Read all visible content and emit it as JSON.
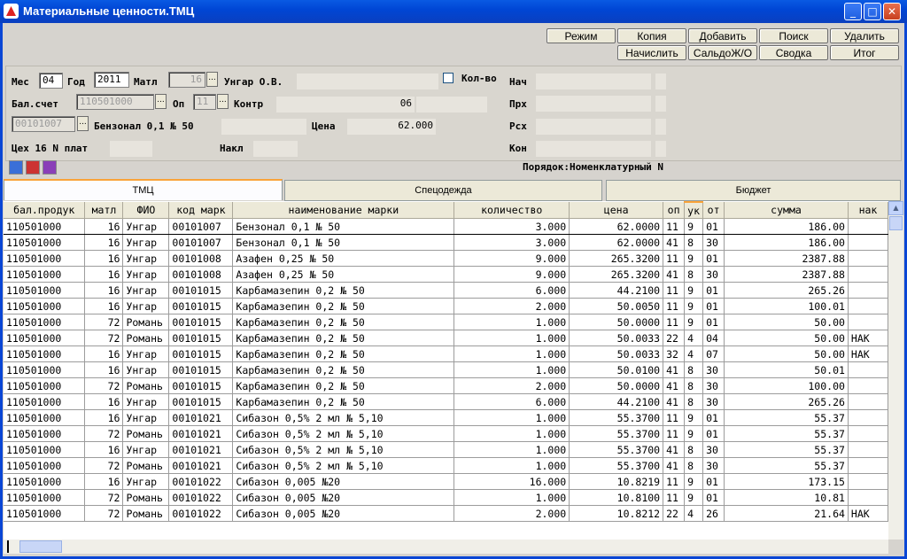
{
  "window": {
    "title": "Материальные ценности.ТМЦ",
    "minimize_icon": "minimize-icon",
    "maximize_icon": "maximize-icon",
    "close_icon": "close-icon"
  },
  "toolbar": {
    "rezhim": "Режим",
    "kopiya": "Копия",
    "dobavit": "Добавить",
    "poisk": "Поиск",
    "udalit": "Удалить",
    "nachislit": "Начислить",
    "saldo": "СальдоЖ/О",
    "svodka": "Сводка",
    "itog": "Итог"
  },
  "form": {
    "mes_label": "Мес",
    "mes_value": "04",
    "god_label": "Год",
    "god_value": "2011",
    "matl_label": "Матл",
    "matl_value": "16",
    "fio_value": "Унгар О.В.",
    "kolvo_label": "Кол-во",
    "nach_label": "Нач",
    "bal_label": "Бал.счет",
    "bal_value": "110501000",
    "op_label": "Оп",
    "op_value": "11",
    "kontr_label": "Контр",
    "kontr_value": "06",
    "prh_label": "Прх",
    "code_value": "00101007",
    "name_value": "Бензонал 0,1 № 50",
    "cena_label": "Цена",
    "cena_value": "62.000",
    "rsh_label": "Рсх",
    "ceh_label": "Цех 16 N плат",
    "nakl_label": "Накл",
    "kon_label": "Кон",
    "order_text": "Порядок:Номенклатурный N"
  },
  "tools": [
    "arrow-down-icon",
    "books-icon",
    "calendar-icon"
  ],
  "tabs": [
    "ТМЦ",
    "Спецодежда",
    "Бюджет"
  ],
  "table": {
    "columns": [
      "бал.продук",
      "матл",
      "ФИО",
      "код марк",
      "наименование марки",
      "количество",
      "цена",
      "оп",
      "ук",
      "от",
      "сумма",
      "нак"
    ],
    "rows": [
      [
        "110501000",
        "16",
        "Унгар",
        "00101007",
        "Бензонал 0,1 № 50",
        "3.000",
        "62.0000",
        "11",
        "9",
        "01",
        "186.00",
        ""
      ],
      [
        "110501000",
        "16",
        "Унгар",
        "00101007",
        "Бензонал 0,1 № 50",
        "3.000",
        "62.0000",
        "41",
        "8",
        "30",
        "186.00",
        ""
      ],
      [
        "110501000",
        "16",
        "Унгар",
        "00101008",
        "Азафен 0,25 № 50",
        "9.000",
        "265.3200",
        "11",
        "9",
        "01",
        "2387.88",
        ""
      ],
      [
        "110501000",
        "16",
        "Унгар",
        "00101008",
        "Азафен 0,25 № 50",
        "9.000",
        "265.3200",
        "41",
        "8",
        "30",
        "2387.88",
        ""
      ],
      [
        "110501000",
        "16",
        "Унгар",
        "00101015",
        "Карбамазепин 0,2 № 50",
        "6.000",
        "44.2100",
        "11",
        "9",
        "01",
        "265.26",
        ""
      ],
      [
        "110501000",
        "16",
        "Унгар",
        "00101015",
        "Карбамазепин 0,2 № 50",
        "2.000",
        "50.0050",
        "11",
        "9",
        "01",
        "100.01",
        ""
      ],
      [
        "110501000",
        "72",
        "Романь",
        "00101015",
        "Карбамазепин 0,2 № 50",
        "1.000",
        "50.0000",
        "11",
        "9",
        "01",
        "50.00",
        ""
      ],
      [
        "110501000",
        "72",
        "Романь",
        "00101015",
        "Карбамазепин 0,2 № 50",
        "1.000",
        "50.0033",
        "22",
        "4",
        "04",
        "50.00",
        "НАК"
      ],
      [
        "110501000",
        "16",
        "Унгар",
        "00101015",
        "Карбамазепин 0,2 № 50",
        "1.000",
        "50.0033",
        "32",
        "4",
        "07",
        "50.00",
        "НАК"
      ],
      [
        "110501000",
        "16",
        "Унгар",
        "00101015",
        "Карбамазепин 0,2 № 50",
        "1.000",
        "50.0100",
        "41",
        "8",
        "30",
        "50.01",
        ""
      ],
      [
        "110501000",
        "72",
        "Романь",
        "00101015",
        "Карбамазепин 0,2 № 50",
        "2.000",
        "50.0000",
        "41",
        "8",
        "30",
        "100.00",
        ""
      ],
      [
        "110501000",
        "16",
        "Унгар",
        "00101015",
        "Карбамазепин 0,2 № 50",
        "6.000",
        "44.2100",
        "41",
        "8",
        "30",
        "265.26",
        ""
      ],
      [
        "110501000",
        "16",
        "Унгар",
        "00101021",
        "Сибазон  0,5% 2 мл № 5,10",
        "1.000",
        "55.3700",
        "11",
        "9",
        "01",
        "55.37",
        ""
      ],
      [
        "110501000",
        "72",
        "Романь",
        "00101021",
        "Сибазон  0,5% 2 мл № 5,10",
        "1.000",
        "55.3700",
        "11",
        "9",
        "01",
        "55.37",
        ""
      ],
      [
        "110501000",
        "16",
        "Унгар",
        "00101021",
        "Сибазон  0,5% 2 мл № 5,10",
        "1.000",
        "55.3700",
        "41",
        "8",
        "30",
        "55.37",
        ""
      ],
      [
        "110501000",
        "72",
        "Романь",
        "00101021",
        "Сибазон  0,5% 2 мл № 5,10",
        "1.000",
        "55.3700",
        "41",
        "8",
        "30",
        "55.37",
        ""
      ],
      [
        "110501000",
        "16",
        "Унгар",
        "00101022",
        "Сибазон 0,005 №20",
        "16.000",
        "10.8219",
        "11",
        "9",
        "01",
        "173.15",
        ""
      ],
      [
        "110501000",
        "72",
        "Романь",
        "00101022",
        "Сибазон 0,005 №20",
        "1.000",
        "10.8100",
        "11",
        "9",
        "01",
        "10.81",
        ""
      ],
      [
        "110501000",
        "72",
        "Романь",
        "00101022",
        "Сибазон 0,005 №20",
        "2.000",
        "10.8212",
        "22",
        "4",
        "26",
        "21.64",
        "НАК"
      ]
    ]
  }
}
